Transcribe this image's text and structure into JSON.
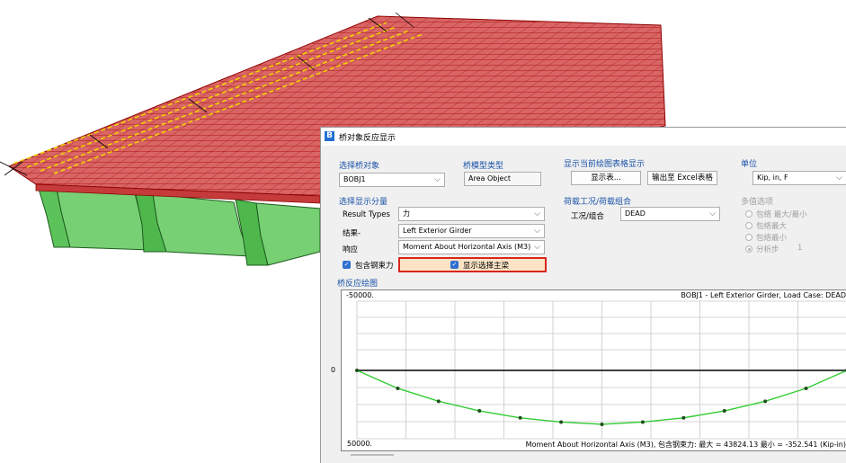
{
  "dialog": {
    "title": "桥对象反应显示",
    "app_icon": "B",
    "select_bridge": {
      "group": "选择桥对象",
      "value": "BOBJ1"
    },
    "model_type": {
      "group": "桥模型类型",
      "value": "Area Object"
    },
    "table_display": {
      "group": "显示当前绘图表格显示",
      "show_table_btn": "显示表...",
      "export_btn": "输出至 Excel表格"
    },
    "units": {
      "group": "单位",
      "value": "Kip, in, F"
    },
    "display_component": {
      "group": "选择显示分量",
      "result_types_label": "Result Types",
      "result_types_value": "力",
      "result_label": "结果-",
      "result_value": "Left Exterior Girder",
      "response_label": "响应",
      "response_value": "Moment About Horizontal Axis  (M3)",
      "include_tendon_label": "包含钢束力",
      "show_main_beam_label": "显示选择主梁"
    },
    "load_case": {
      "group": "荷载工况/荷载组合",
      "label": "工况/组合",
      "value": "DEAD"
    },
    "multi_value": {
      "group": "多值选项",
      "options": [
        "包络 最大/最小",
        "包络最大",
        "包络最小",
        "分析步"
      ],
      "step_value": "1"
    },
    "plot": {
      "group": "桥反应绘图",
      "header_text": "BOBJ1 - Left Exterior Girder,  Load Case: DEAD",
      "footer_text": "Moment About Horizontal Axis  (M3), 包含钢束力:  最大 = 43824.13   最小 = -352.541  (Kip-in)"
    }
  },
  "chart_data": {
    "type": "line",
    "tick_labels": [
      "-50000.",
      "0",
      "50000."
    ],
    "ylim": [
      -50000,
      50000
    ],
    "y_inverted": true,
    "grid": true,
    "max": 43824.13,
    "min": -352.541,
    "series": [
      {
        "x": [
          0,
          1,
          2,
          3,
          4,
          5,
          6,
          7,
          8,
          9,
          10,
          11,
          12
        ],
        "values": [
          0,
          14600,
          25100,
          32900,
          38600,
          42000,
          43824,
          42000,
          38600,
          32900,
          25100,
          14600,
          0
        ]
      }
    ]
  },
  "colors": {
    "accent": "#1a52a8",
    "curve": "#33cc33",
    "highlight_border": "#d9261c",
    "highlight_fill": "#fbe4c6"
  }
}
